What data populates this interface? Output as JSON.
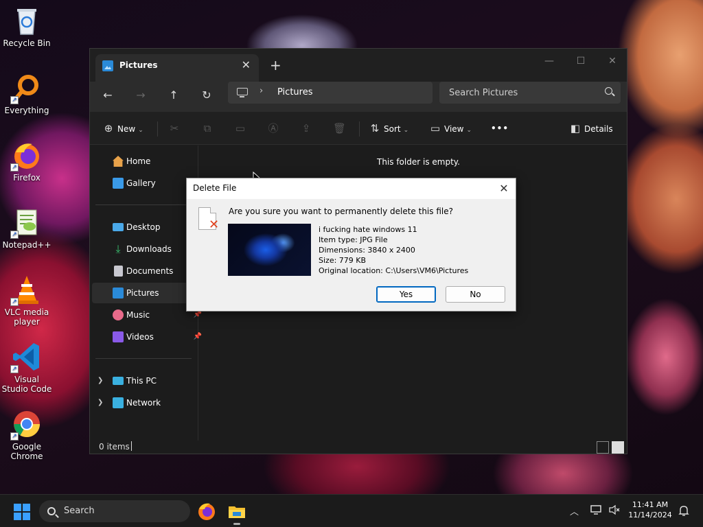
{
  "desktop": {
    "icons": [
      {
        "label": "Recycle Bin"
      },
      {
        "label": "Everything"
      },
      {
        "label": "Firefox"
      },
      {
        "label": "Notepad++"
      },
      {
        "label": "VLC media player"
      },
      {
        "label": "Visual Studio Code"
      },
      {
        "label": "Google Chrome"
      }
    ]
  },
  "explorer": {
    "tab_title": "Pictures",
    "address": {
      "path": "Pictures"
    },
    "search_placeholder": "Search Pictures",
    "toolbar": {
      "new_label": "New",
      "sort_label": "Sort",
      "view_label": "View",
      "more_label": "•••",
      "details_label": "Details"
    },
    "sidebar": {
      "items": [
        {
          "label": "Home"
        },
        {
          "label": "Gallery"
        },
        {
          "label": "Desktop"
        },
        {
          "label": "Downloads"
        },
        {
          "label": "Documents"
        },
        {
          "label": "Pictures"
        },
        {
          "label": "Music"
        },
        {
          "label": "Videos"
        },
        {
          "label": "This PC"
        },
        {
          "label": "Network"
        }
      ]
    },
    "empty_message": "This folder is empty.",
    "status": {
      "item_count": "0 items"
    }
  },
  "dialog": {
    "title": "Delete File",
    "question": "Are you sure you want to permanently delete this file?",
    "file": {
      "name": "i fucking hate windows 11",
      "item_type": "Item type: JPG File",
      "dimensions": "Dimensions: 3840 x 2400",
      "size": "Size: 779 KB",
      "location": "Original location: C:\\Users\\VM6\\Pictures"
    },
    "yes_label": "Yes",
    "no_label": "No"
  },
  "taskbar": {
    "search_label": "Search",
    "time": "11:41 AM",
    "date": "11/14/2024"
  },
  "colors": {
    "accent": "#0067c0",
    "folder_blue": "#2a8ad8",
    "delete_red": "#e0401c"
  }
}
